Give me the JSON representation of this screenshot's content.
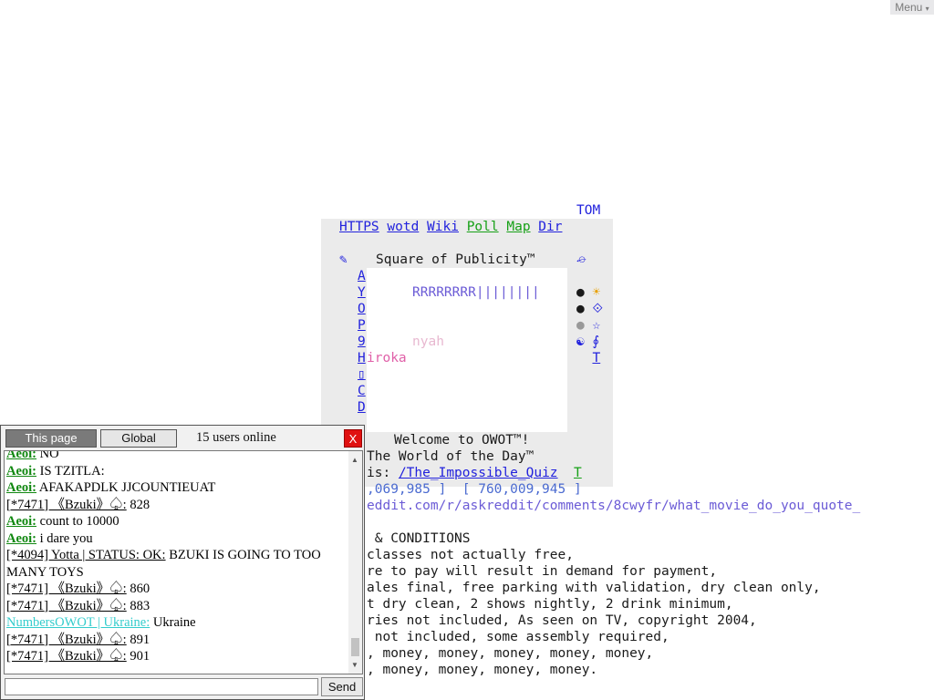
{
  "menu": {
    "label": "Menu",
    "caret": "▾"
  },
  "owot": {
    "tom": "TOM",
    "nav": {
      "https": "HTTPS",
      "wotd": "wotd",
      "wiki": "Wiki",
      "poll": "Poll",
      "map": "Map",
      "dir": "Dir"
    },
    "square_title": "Square of Publicity™",
    "left_icon": "✎",
    "right_icon": "⌮",
    "side_letters": [
      "A",
      "Y",
      "O",
      "P",
      "9",
      "H",
      "▯",
      "C",
      "D"
    ],
    "rrr_line": "RRRRRRRR||||||||",
    "nyah": "nyah",
    "hiroka": "iroka",
    "right_icons": [
      "●",
      "☀",
      "●",
      "⟐",
      "●",
      "☆",
      "☯",
      "∮",
      "T"
    ],
    "welcome": "Welcome to OWOT™!",
    "world_of_day": "The World of the Day™",
    "is_label": "is:",
    "world_link": "/The_Impossible_Quiz",
    "world_t": "T",
    "coords": ",069,985 ]  [ 760,009,945 ]",
    "reddit": "eddit.com/r/askreddit/comments/8cwyfr/what_movie_do_you_quote_",
    "terms": [
      " & CONDITIONS",
      "classes not actually free,",
      "re to pay will result in demand for payment,",
      "ales final, free parking with validation, dry clean only,",
      "t dry clean, 2 shows nightly, 2 drink minimum,",
      "ries not included, As seen on TV, copyright 2004,",
      " not included, some assembly required,",
      ", money, money, money, money, money,",
      ", money, money, money, money."
    ]
  },
  "chat": {
    "tab_this": "This page",
    "tab_global": "Global",
    "users_online": "15 users online",
    "close": "X",
    "send": "Send",
    "input_value": "",
    "messages": [
      {
        "nick": "Aeoi:",
        "text": "NO"
      },
      {
        "nick": "Aeoi:",
        "text": "IS TZITLA:"
      },
      {
        "nick": "Aeoi:",
        "text": "AFAKAPDLK JJCOUNTIEUAT"
      },
      {
        "nick": "[*7471] 《Bzuki》♤:",
        "text": "828"
      },
      {
        "nick": "Aeoi:",
        "text": "count to 10000"
      },
      {
        "nick": "Aeoi:",
        "text": "i dare you"
      },
      {
        "nick": "[*4094] Yotta | STATUS: OK:",
        "text": "BZUKI IS GOING TO TOO MANY TOYS"
      },
      {
        "nick": "[*7471] 《Bzuki》♤:",
        "text": "860"
      },
      {
        "nick": "[*7471] 《Bzuki》♤:",
        "text": "883"
      },
      {
        "nick": "NumbersOWOT | Ukraine:",
        "text": "Ukraine"
      },
      {
        "nick": "[*7471] 《Bzuki》♤:",
        "text": "891"
      },
      {
        "nick": "[*7471] 《Bzuki》♤:",
        "text": "901"
      }
    ]
  }
}
